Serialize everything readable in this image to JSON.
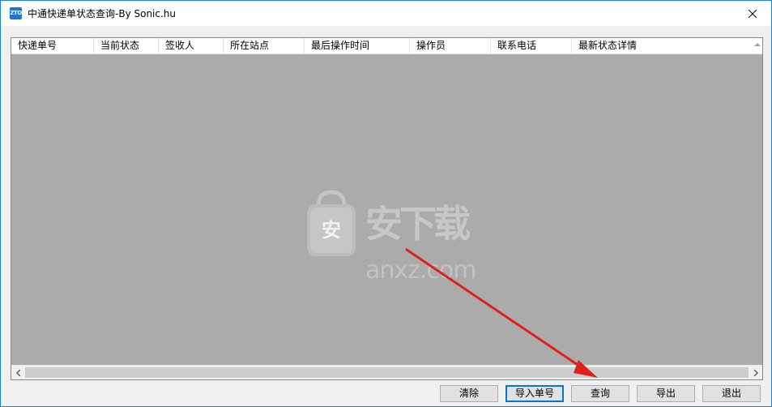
{
  "window": {
    "title": "中通快递单状态查询-By Sonic.hu",
    "icon_text": "ZTO",
    "close_symbol": "✕"
  },
  "list": {
    "columns": [
      "快递单号",
      "当前状态",
      "签收人",
      "所在站点",
      "最后操作时间",
      "操作员",
      "联系电话",
      "最新状态详情"
    ],
    "rows": []
  },
  "watermark": {
    "badge": "安",
    "title": "安下载",
    "domain": "anxz.com"
  },
  "buttons": {
    "clear": "清除",
    "import": "导入单号",
    "query": "查询",
    "export": "导出",
    "exit": "退出"
  },
  "colors": {
    "list_bg": "#ababab",
    "window_border": "#1883d7",
    "annotation_arrow": "#e0201b"
  }
}
